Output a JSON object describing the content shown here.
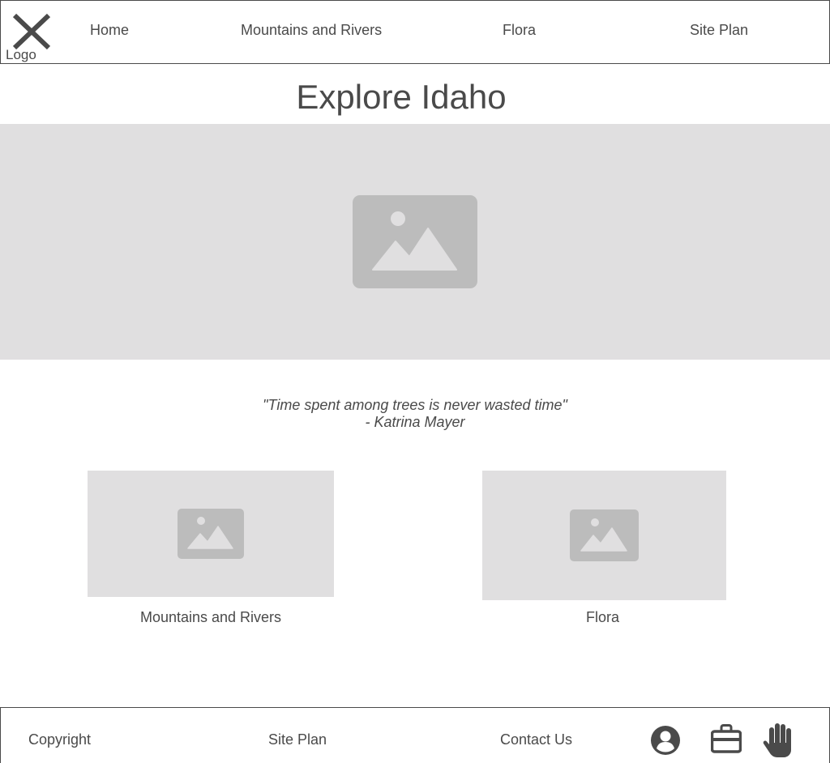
{
  "colors": {
    "text": "#4a4a4a",
    "placeholder_bg": "#e0dfe0",
    "placeholder_icon": "#bcbcbc",
    "border": "#4a4a4a"
  },
  "header": {
    "logo_icon": "close-x-icon",
    "logo_label": "Logo",
    "nav": [
      {
        "label": "Home"
      },
      {
        "label": "Mountains and Rivers"
      },
      {
        "label": "Flora"
      },
      {
        "label": "Site Plan"
      }
    ]
  },
  "main": {
    "title": "Explore Idaho",
    "hero_icon": "image-placeholder-icon",
    "quote": {
      "text": "\"Time spent among trees is never wasted time\"",
      "author": "- Katrina Mayer"
    },
    "cards": [
      {
        "label": "Mountains and Rivers",
        "icon": "image-placeholder-icon"
      },
      {
        "label": "Flora",
        "icon": "image-placeholder-icon"
      }
    ]
  },
  "footer": {
    "links": [
      {
        "label": "Copyright"
      },
      {
        "label": "Site Plan"
      },
      {
        "label": "Contact Us"
      }
    ],
    "icons": [
      "user-circle-icon",
      "briefcase-icon",
      "hand-icon"
    ]
  }
}
